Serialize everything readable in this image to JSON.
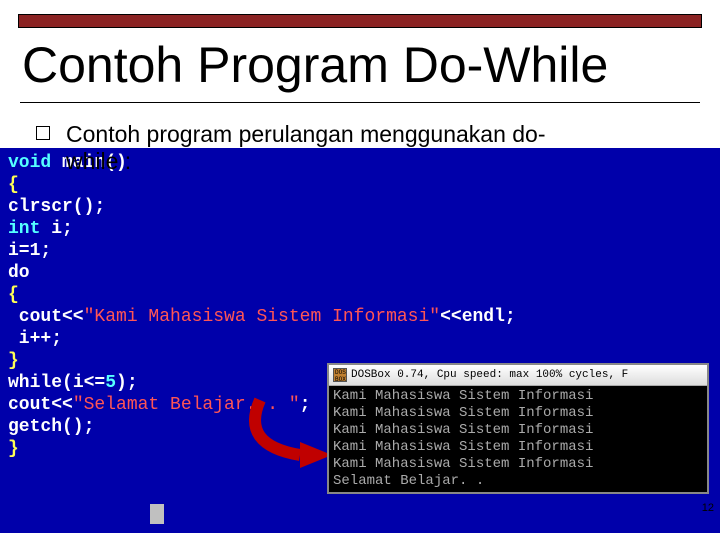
{
  "title": "Contoh Program Do-While",
  "bullet": "Contoh program perulangan menggunakan do-",
  "bullet_wrap": "while :",
  "code": {
    "l1a": "void",
    "l1b": " main()",
    "l2": "{",
    "l3": "clrscr();",
    "l4a": "int",
    "l4b": " i;",
    "l5": "i=1;",
    "l6": "do",
    "l7": "{",
    "l8a": " cout<<",
    "l8b": "\"Kami Mahasiswa Sistem Informasi\"",
    "l8c": "<<endl;",
    "l9": " i++;",
    "l10": "}",
    "l11a": "while",
    "l11b": "(i<=",
    "l11c": "5",
    "l11d": ");",
    "l12a": "cout<<",
    "l12b": "\"Selamat Belajar. . \"",
    "l12c": ";",
    "l13": "getch();",
    "l14": "}"
  },
  "output": {
    "titlebar": "DOSBox 0.74, Cpu speed: max 100% cycles, F",
    "lines": [
      "Kami Mahasiswa Sistem Informasi",
      "Kami Mahasiswa Sistem Informasi",
      "Kami Mahasiswa Sistem Informasi",
      "Kami Mahasiswa Sistem Informasi",
      "Kami Mahasiswa Sistem Informasi",
      "Selamat Belajar. ."
    ]
  },
  "page_number": "12",
  "dos_icon_text": "DOS BOX"
}
